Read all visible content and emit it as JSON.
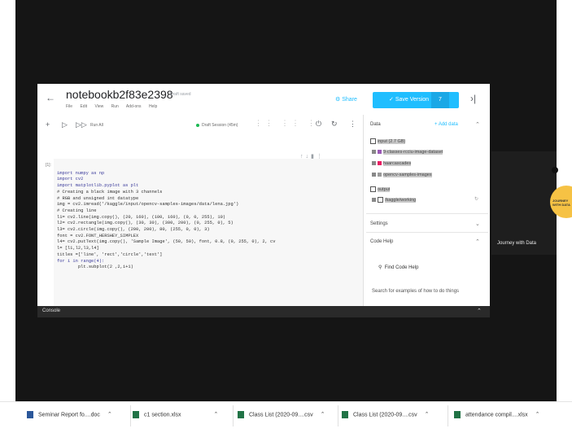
{
  "notebook": {
    "title": "notebookb2f83e2398",
    "draft_status": "Draft saved",
    "back_icon": "back-arrow-icon",
    "menu": [
      "File",
      "Edit",
      "View",
      "Run",
      "Add-ons",
      "Help"
    ],
    "share_label": "Share",
    "save_version_label": "Save Version",
    "version_number": "7",
    "toolbar": {
      "run_all_label": "Run All",
      "session_label": "Draft Session (45m)"
    },
    "cell_prompt": "[1]:",
    "code_lines": [
      "import numpy as np",
      "import cv2",
      "import matplotlib.pyplot as plt",
      "# Creating a black image with 3 channels",
      "# RGB and unsigned int datatype",
      "img = cv2.imread('/kaggle/input/opencv-samples-images/data/lena.jpg')",
      "# Creating line",
      "l1= cv2.line(img.copy(), (20, 160), (100, 160), (0, 0, 255), 10)",
      "l2= cv2.rectangle(img.copy(), (30, 30), (300, 200), (0, 255, 0), 5)",
      "l3= cv2.circle(img.copy(), (200, 200), 80, (255, 0, 0), 3)",
      "font = cv2.FONT_HERSHEY_SIMPLEX",
      "l4= cv2.putText(img.copy(), 'Sample Image', (50, 50), font, 0.8, (0, 255, 0), 2, cv",
      "l= [l1,l2,l3,l4]",
      "titles =['line', 'rect','circle','text']",
      "for i in range(4):",
      "        plt.subplot(2 ,2,i+1)"
    ]
  },
  "sidebar": {
    "data_label": "Data",
    "add_data_label": "+ Add data",
    "input_label": "input (2.7 GB)",
    "datasets": [
      "9-classes-rcciu-image-dataset",
      "haarcascades",
      "opencv-samples-images"
    ],
    "output_label": "output",
    "output_item": "/kaggle/working",
    "settings_label": "Settings",
    "code_help_label": "Code Help",
    "find_code_label": "Find Code Help",
    "search_hint": "Search for examples of how to do things"
  },
  "console": {
    "label": "Console"
  },
  "participant": {
    "name": "Journey with Data",
    "logo_text": "JOURNEY WITH DATA"
  },
  "downloads": [
    {
      "name": "Seminar Report fo....doc",
      "icon": "word-doc-icon"
    },
    {
      "name": "c1 section.xlsx",
      "icon": "excel-file-icon"
    },
    {
      "name": "Class List (2020-09....csv",
      "icon": "excel-file-icon"
    },
    {
      "name": "Class List (2020-09....csv",
      "icon": "excel-file-icon"
    },
    {
      "name": "attendance compil....xlsx",
      "icon": "excel-file-icon"
    }
  ],
  "colors": {
    "accent": "#20beff",
    "screen_bg": "#151515",
    "console_bg": "#2a2a2a",
    "session_green": "#1db954"
  }
}
